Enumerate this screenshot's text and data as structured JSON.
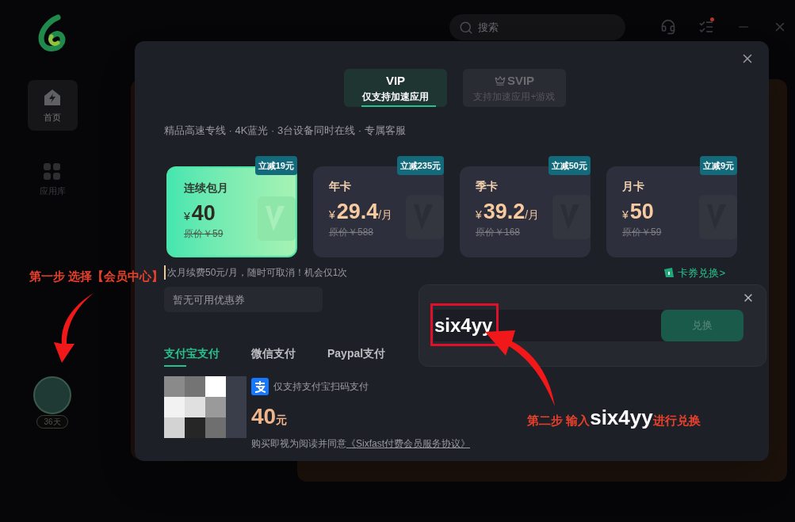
{
  "sidebar": {
    "items": [
      {
        "label": "首页",
        "selected": true
      },
      {
        "label": "应用库",
        "selected": false
      }
    ],
    "avatar_badge": "36天"
  },
  "top_bar": {
    "search": {
      "placeholder": "搜索"
    }
  },
  "modal": {
    "tabs": [
      {
        "title": "VIP",
        "subtitle": "仅支持加速应用",
        "selected": true
      },
      {
        "title": "SVIP",
        "subtitle": "支持加速应用+游戏",
        "selected": false
      }
    ],
    "features": "精品高速专线 · 4K蓝光 · 3台设备同时在线 · 专属客服",
    "plans": [
      {
        "name": "连续包月",
        "currency": "¥",
        "price": "40",
        "original": "原价￥59",
        "badge": "立减19元",
        "selected": true
      },
      {
        "name": "年卡",
        "currency": "¥",
        "price": "29.4",
        "unit": "/月",
        "original": "原价￥588",
        "badge": "立减235元",
        "selected": false
      },
      {
        "name": "季卡",
        "currency": "¥",
        "price": "39.2",
        "unit": "/月",
        "original": "原价￥168",
        "badge": "立减50元",
        "selected": false
      },
      {
        "name": "月卡",
        "currency": "¥",
        "price": "50",
        "original": "原价￥59",
        "badge": "立减9元",
        "selected": false
      }
    ],
    "renewal_note": "次月续费50元/月，随时可取消！机会仅1次",
    "card_exchange_link": "卡券兑换>",
    "coupon": {
      "placeholder": "暂无可用优惠券"
    },
    "redeem": {
      "value": "six4yy",
      "button": "兑换"
    },
    "payment_tabs": [
      {
        "label": "支付宝支付",
        "selected": true
      },
      {
        "label": "微信支付",
        "selected": false
      },
      {
        "label": "Paypal支付",
        "selected": false
      }
    ],
    "payment": {
      "note": "仅支持支付宝扫码支付",
      "amount": "40",
      "amount_unit": "元",
      "agreement": "购买即视为阅读并同意",
      "agreement_link": "《Sixfast付费会员服务协议》"
    }
  },
  "annotations": [
    {
      "parts": [
        {
          "text": "第一步 选择【会员中心】",
          "kind": "plain"
        }
      ]
    },
    {
      "parts": [
        {
          "text": "第二步 输入",
          "kind": "plain"
        },
        {
          "text": "six4yy",
          "kind": "highlight"
        },
        {
          "text": "进行兑换",
          "kind": "plain"
        }
      ]
    }
  ]
}
